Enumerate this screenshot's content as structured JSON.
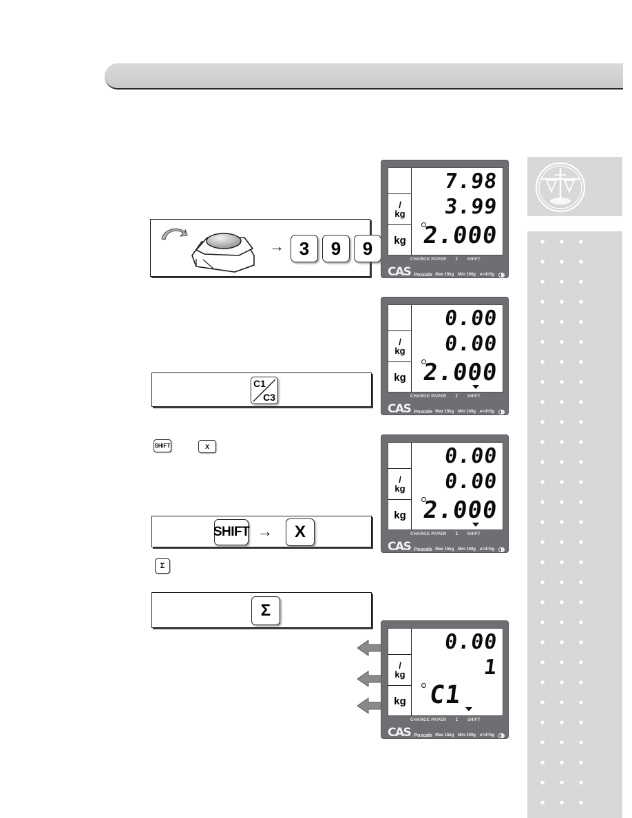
{
  "header": {
    "title": ""
  },
  "sidebar": {
    "logo_icon": "balance-scale-icon",
    "dots_pattern": "dot-grid-pattern"
  },
  "steps": [
    {
      "id": "step-enter-price",
      "icon": "rotate-arrow-icon",
      "device_icon": "bench-scale-icon",
      "arrow": "→",
      "keys": [
        "3",
        "9",
        "9"
      ]
    },
    {
      "id": "step-preset-key",
      "key_top": "C1",
      "key_bottom": "C3"
    },
    {
      "id": "step-shift-x",
      "inline_keys": [
        "SHIFT",
        "X"
      ],
      "key_left": "SHIFT",
      "arrow": "→",
      "key_right": "X"
    },
    {
      "id": "step-sigma",
      "inline_key": "Σ",
      "key": "Σ"
    }
  ],
  "displays": [
    {
      "id": "display-1",
      "labels": {
        "blank": "",
        "per_kg_top": "/",
        "per_kg_bottom": "kg",
        "kg": "kg"
      },
      "row1": "7.98",
      "row2": "3.99",
      "row3": "2.000",
      "zero_indicator": "zero-marker",
      "triangle": false,
      "status": [
        "CHARGE PAPER",
        "Σ",
        "SHIFT"
      ],
      "brand": "CAS",
      "model": "Poscale",
      "specs": [
        "Max 15kg",
        "Min 100g",
        "e=d=5g"
      ],
      "arrows": false
    },
    {
      "id": "display-2",
      "labels": {
        "blank": "",
        "per_kg_top": "/",
        "per_kg_bottom": "kg",
        "kg": "kg"
      },
      "row1": "0.00",
      "row2": "0.00",
      "row3": "2.000",
      "zero_indicator": "zero-marker",
      "triangle": true,
      "status": [
        "CHARGE PAPER",
        "Σ",
        "SHIFT"
      ],
      "brand": "CAS",
      "model": "Poscale",
      "specs": [
        "Max 15kg",
        "Min 100g",
        "e=d=5g"
      ],
      "arrows": false
    },
    {
      "id": "display-3",
      "labels": {
        "blank": "",
        "per_kg_top": "/",
        "per_kg_bottom": "kg",
        "kg": "kg"
      },
      "row1": "0.00",
      "row2": "0.00",
      "row3": "2.000",
      "zero_indicator": "zero-marker",
      "triangle": true,
      "status": [
        "CHARGE PAPER",
        "Σ",
        "SHIFT"
      ],
      "brand": "CAS",
      "model": "Poscale",
      "specs": [
        "Max 15kg",
        "Min 100g",
        "e=d=5g"
      ],
      "arrows": false
    },
    {
      "id": "display-4",
      "labels": {
        "blank": "",
        "per_kg_top": "/",
        "per_kg_bottom": "kg",
        "kg": "kg"
      },
      "row1": "0.00",
      "row2": "1",
      "row3": "C1",
      "zero_indicator": "zero-marker",
      "triangle": true,
      "status": [
        "CHARGE PAPER",
        "Σ",
        "SHIFT"
      ],
      "brand": "CAS",
      "model": "Poscale",
      "specs": [
        "Max 15kg",
        "Min 100g",
        "e=d=5g"
      ],
      "arrows": true
    }
  ]
}
